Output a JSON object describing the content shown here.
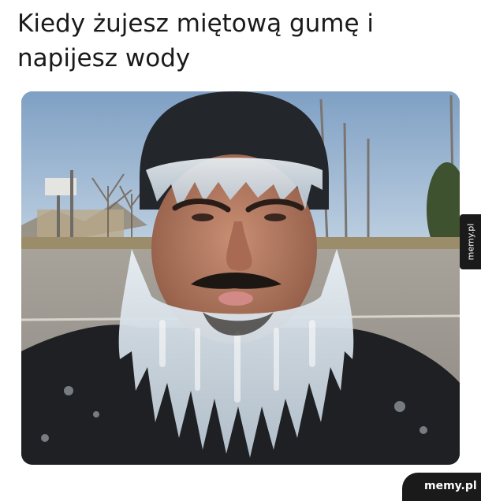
{
  "caption": {
    "line1": "Kiedy żujesz miętową gumę i",
    "line2": "napijesz wody"
  },
  "watermark": {
    "side_text": "memy.pl",
    "corner_text": "memy.pl"
  },
  "photo": {
    "icon": "frozen-bearded-man-photo"
  }
}
